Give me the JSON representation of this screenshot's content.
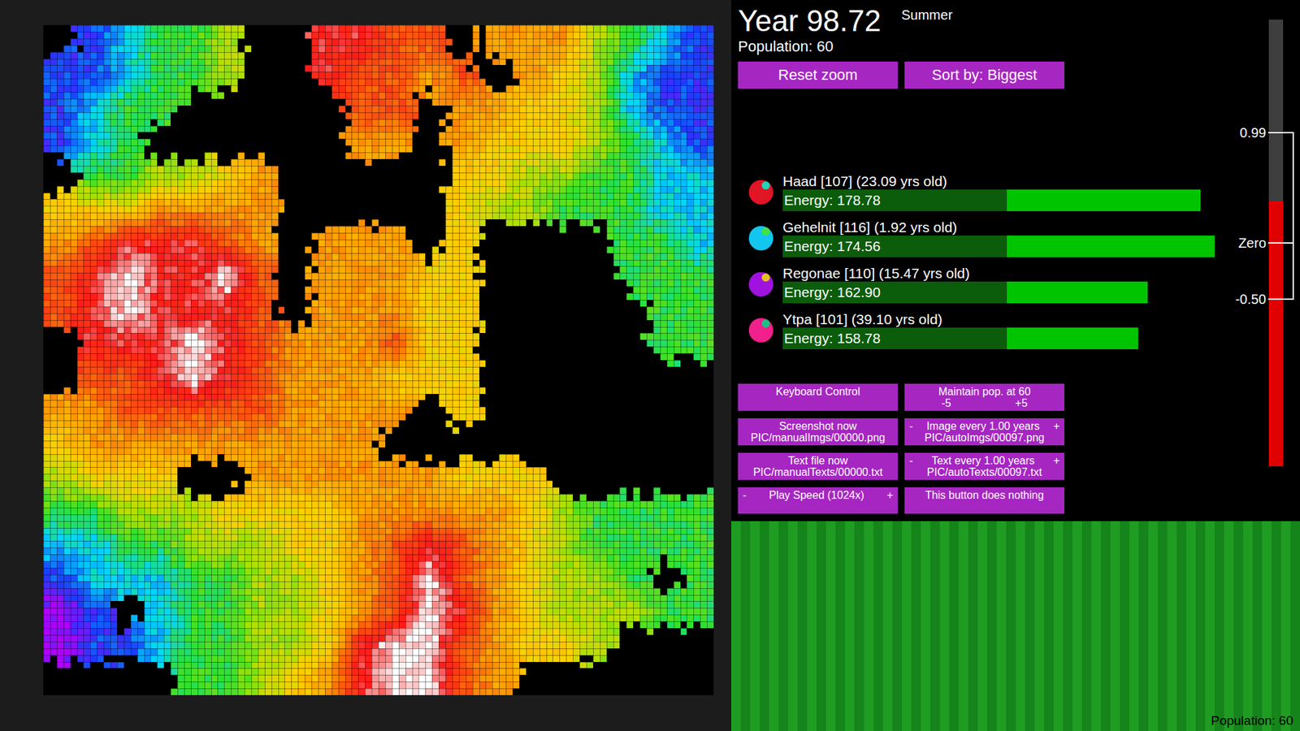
{
  "header": {
    "year": "Year 98.72",
    "season": "Summer",
    "population": "Population: 60"
  },
  "top_buttons": [
    "Reset zoom",
    "Sort by: Biggest"
  ],
  "creatures": [
    {
      "name": "Haad [107] (23.09 yrs old)",
      "energy": "Energy: 178.78",
      "level": 0.9,
      "color": "#e01525",
      "mouth_color": "#22d4b4"
    },
    {
      "name": "Gehelnit [116] (1.92 yrs old)",
      "energy": "Energy: 174.56",
      "level": 0.93,
      "color": "#12c6f0",
      "mouth_color": "#44e044"
    },
    {
      "name": "Regonae [110] (15.47 yrs old)",
      "energy": "Energy: 162.90",
      "level": 0.786,
      "color": "#a012e0",
      "mouth_color": "#e6c020"
    },
    {
      "name": "Ytpa [101] (39.10 yrs old)",
      "energy": "Energy: 158.78",
      "level": 0.766,
      "color": "#f0208c",
      "mouth_color": "#20c080"
    }
  ],
  "controls": [
    {
      "lines": [
        [
          "Keyboard Control"
        ]
      ]
    },
    {
      "lines": [
        [
          "Maintain pop. at 60"
        ],
        [
          "-5",
          "+5"
        ]
      ]
    },
    {
      "lines": [
        [
          "Screenshot now"
        ],
        [
          "PIC/manualImgs/00000.png"
        ]
      ]
    },
    {
      "lines": [
        [
          "-",
          "Image every 1.00 years",
          "+"
        ],
        [
          "PIC/autoImgs/00097.png"
        ]
      ]
    },
    {
      "lines": [
        [
          "Text file now"
        ],
        [
          "PIC/manualTexts/00000.txt"
        ]
      ]
    },
    {
      "lines": [
        [
          "-",
          "Text every 1.00 years",
          "+"
        ],
        [
          "PIC/autoTexts/00097.txt"
        ]
      ]
    },
    {
      "lines": [
        [
          "-",
          "Play Speed (1024x)",
          "+"
        ]
      ]
    },
    {
      "lines": [
        [
          "This button does nothing"
        ]
      ]
    }
  ],
  "meter": {
    "level": 0.594,
    "range": [
      -2,
      2
    ],
    "ticks": [
      {
        "label": "0.99",
        "value": 0.99
      },
      {
        "label": "Zero",
        "value": 0
      },
      {
        "label": "-0.50",
        "value": -0.5
      }
    ]
  },
  "map": {
    "rows": [
      ".12334..8877.6664321",
      "112334..87767.654211",
      "1233.....77.66554211",
      "123......66.65554321",
      ".334456.....55443322",
      "5556666.....54433322",
      "6788876.666.5....332",
      "7898897.66655....333",
      "7898887.66655.....33",
      ".888987666755.....33",
      ".778987666555.......",
      "66777776666.5.......",
      "5666666666..........",
      "4555..666666555.....",
      "33444555566666543333",
      "22334445567876543333",
      "122233445679765443.3",
      "01.23344567986544433",
      "01123344589976554...",
      "....3345689976......"
    ]
  },
  "population_chart": {
    "label": "Population: 60",
    "max": 60,
    "values": [
      60,
      60,
      60,
      60,
      60,
      60,
      60,
      60,
      60,
      60,
      60,
      60,
      60,
      60,
      60,
      60,
      60,
      60,
      60,
      60,
      60,
      60,
      60,
      60,
      60,
      60,
      60,
      60,
      60,
      60,
      60,
      60,
      60,
      60,
      60,
      60,
      60,
      60,
      60,
      60,
      60,
      60,
      60,
      60,
      60,
      60,
      60,
      60,
      60,
      60,
      60,
      60,
      60,
      60,
      60,
      60,
      60,
      60,
      60,
      60
    ]
  }
}
